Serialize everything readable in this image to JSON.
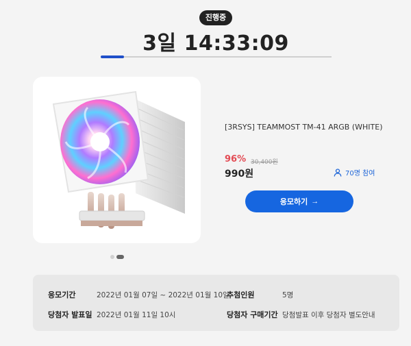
{
  "status_badge": "진행중",
  "countdown": "3일 14:33:09",
  "progress_fraction": 0.1,
  "product": {
    "title": "[3RSYS] TEAMMOST TM-41 ARGB (WHITE)",
    "discount_rate": "96%",
    "original_price": "30,400원",
    "sale_price": "990원",
    "participants": "70명 참여",
    "apply_label": "응모하기",
    "apply_arrow": "→"
  },
  "slides": {
    "total": 2,
    "active": 2
  },
  "info": {
    "period_label": "응모기간",
    "period_value": "2022년 01월 07일 ~ 2022년 01월 10일",
    "winners_label": "추첨인원",
    "winners_value": "5명",
    "announce_label": "당첨자 발표일",
    "announce_value": "2022년 01월 11일 10시",
    "purchase_label": "당첨자 구매기간",
    "purchase_value": "당첨발표 이후 당첨자 별도안내"
  },
  "colors": {
    "accent": "#1666e0",
    "discount": "#e34b54",
    "progress": "#1f4fc9"
  },
  "icons": [
    "person-icon",
    "arrow-right-icon"
  ]
}
